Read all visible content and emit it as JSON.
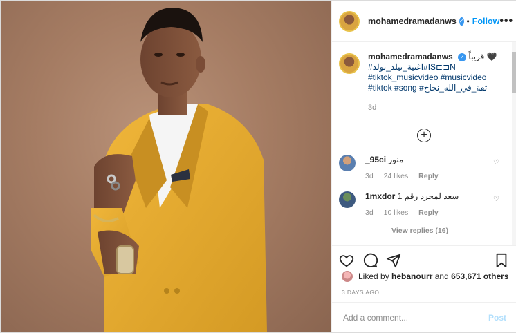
{
  "header": {
    "username": "mohamedramadanws",
    "dot": "•",
    "follow_label": "Follow",
    "more_label": "•••"
  },
  "caption": {
    "username": "mohamedramadanws",
    "text_rtl": "قريباً 🖤",
    "tag1": "#اغنية_تيلد_تولد#IS⊏⊐N",
    "tag2": "#tiktok_musicvideo #musicvideo",
    "tag3": "#tiktok #song #ثقة_في_الله_نجاح",
    "time": "3d"
  },
  "comments": [
    {
      "username": "_95ci",
      "text": "منور",
      "time": "3d",
      "likes": "24 likes",
      "reply": "Reply"
    },
    {
      "username": "1mxdor",
      "text": "1 سعد لمجرد رقم",
      "time": "3d",
      "likes": "10 likes",
      "reply": "Reply"
    }
  ],
  "view_replies": "View replies (16)",
  "likes": {
    "prefix": "Liked by",
    "user": "hebanourr",
    "middle": "and",
    "count": "653,671 others"
  },
  "date": "3 DAYS AGO",
  "add_comment": {
    "placeholder": "Add a comment...",
    "post_label": "Post"
  },
  "colors": {
    "accent": "#0095f6",
    "jacket": "#e3a72f",
    "background": "#a57c63"
  }
}
